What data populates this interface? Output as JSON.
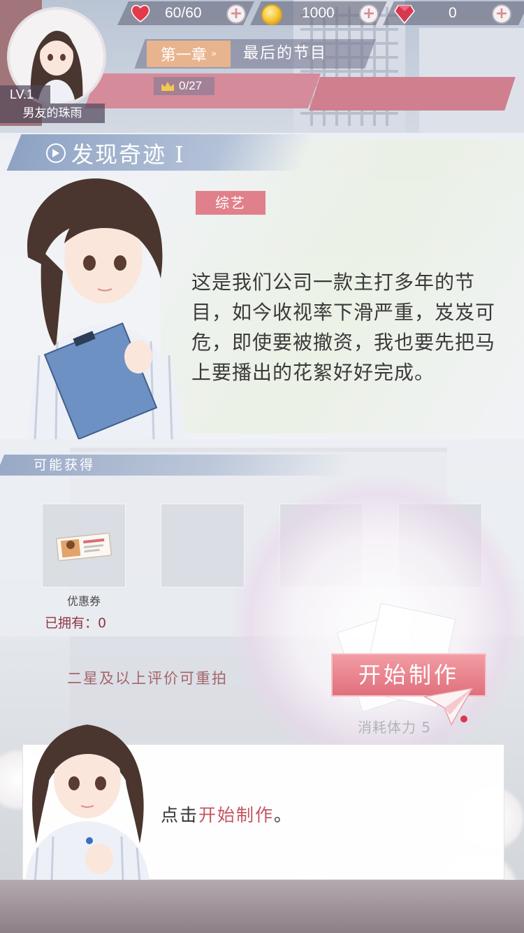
{
  "player": {
    "level": "LV.1",
    "name": "男友的珠雨",
    "avatar_icon": "girl-avatar-icon"
  },
  "resources": {
    "stamina": {
      "value": "60/60",
      "icon": "heart-icon",
      "color": "#e23a4a"
    },
    "coins": {
      "value": "1000",
      "icon": "coin-icon",
      "color": "#f4c334"
    },
    "gems": {
      "value": "0",
      "icon": "gem-icon",
      "color": "#d63850"
    }
  },
  "chapter": {
    "label": "第一章",
    "title": "最后的节目",
    "progress": "0/27"
  },
  "episode": {
    "title": "发现奇迹 I",
    "genre": "综艺",
    "description": "这是我们公司一款主打多年的节目，如今收视率下滑严重，岌岌可危，即使要被撤资，我也要先把马上要播出的花絮好好完成。"
  },
  "rewards": {
    "header": "可能获得",
    "items": [
      {
        "label": "优惠券",
        "icon": "coupon-ticket-icon"
      }
    ],
    "owned": "已拥有：0"
  },
  "actions": {
    "reshoot_hint": "二星及以上评价可重拍",
    "start_label": "开始制作",
    "cost_label": "消耗体力 5"
  },
  "dialog": {
    "prefix": "点击",
    "highlight": "开始制作",
    "suffix": "。"
  },
  "colors": {
    "accent_pink": "#e0707d",
    "genre_tag": "#e0808a",
    "chapter_tag": "#e8b48e",
    "dialog_highlight": "#c55460"
  }
}
